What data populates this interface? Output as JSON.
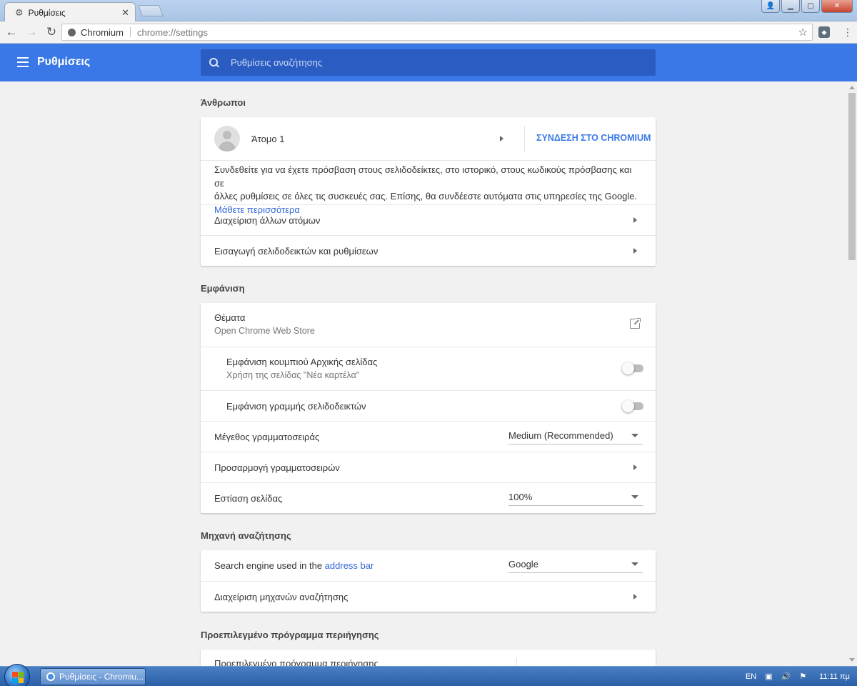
{
  "window": {
    "tab_title": "Ρυθμίσεις",
    "tab_icon": "gear-icon",
    "close_tab": "✕"
  },
  "toolbar": {
    "site_label": "Chromium",
    "url": "chrome://settings"
  },
  "header": {
    "title": "Ρυθμίσεις",
    "search_placeholder": "Ρυθμίσεις αναζήτησης"
  },
  "sections": {
    "people": {
      "title": "Άνθρωποι",
      "profile_name": "Άτομο 1",
      "sign_in_button": "ΣΥΝΔΕΣΗ ΣΤΟ CHROMIUM",
      "description_line1": "Συνδεθείτε για να έχετε πρόσβαση στους σελιδοδείκτες, στο ιστορικό, στους κωδικούς πρόσβασης και σε",
      "description_line2": "άλλες ρυθμίσεις σε όλες τις συσκευές σας. Επίσης, θα συνδέεστε αυτόματα στις υπηρεσίες της Google.",
      "learn_more": "Μάθετε περισσότερα",
      "manage_people": "Διαχείριση άλλων ατόμων",
      "import": "Εισαγωγή σελιδοδεικτών και ρυθμίσεων"
    },
    "appearance": {
      "title": "Εμφάνιση",
      "themes_label": "Θέματα",
      "themes_sub": "Open Chrome Web Store",
      "home_button_label": "Εμφάνιση κουμπιού Αρχικής σελίδας",
      "home_button_sub": "Χρήση της σελίδας \"Νέα καρτέλα\"",
      "home_button_on": false,
      "bookmarks_bar_label": "Εμφάνιση γραμμής σελιδοδεικτών",
      "bookmarks_bar_on": false,
      "font_size_label": "Μέγεθος γραμματοσειράς",
      "font_size_value": "Medium (Recommended)",
      "customize_fonts": "Προσαρμογή γραμματοσειρών",
      "page_zoom_label": "Εστίαση σελίδας",
      "page_zoom_value": "100%"
    },
    "search_engine": {
      "title": "Μηχανή αναζήτησης",
      "used_in_prefix": "Search engine used in the ",
      "address_bar_link": "address bar",
      "engine_value": "Google",
      "manage": "Διαχείριση μηχανών αναζήτησης"
    },
    "default_browser": {
      "title": "Προεπιλεγμένο πρόγραμμα περιήγησης",
      "row_label": "Προεπιλεγμένο πρόγραμμα περιήγησης"
    }
  },
  "taskbar": {
    "task_label": "Ρυθμίσεις - Chromiu...",
    "lang": "EN",
    "time": "11:11 πμ"
  },
  "colors": {
    "accent": "#3b78e7",
    "link": "#3367d6"
  }
}
